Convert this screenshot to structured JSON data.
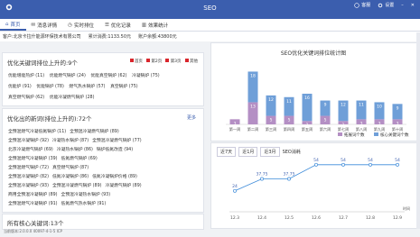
{
  "window": {
    "title": "SEO",
    "kefu": "客服",
    "settings": "设置"
  },
  "tabs": [
    {
      "label": "首页"
    },
    {
      "label": "消息详情"
    },
    {
      "label": "实时排位"
    },
    {
      "label": "优化记录"
    },
    {
      "label": "效果统计"
    }
  ],
  "info": {
    "customer": "客户:北京卡拉什能源环保技术有限公司",
    "spent": "累计消费:1133.50元",
    "balance": "账户余额:43800元"
  },
  "stats": {
    "title": "优化关键词排位上升的:9个",
    "legend": [
      "首页",
      "第2页",
      "第3页",
      "其他"
    ],
    "rows": [
      [
        "优能增能热炉 (11)",
        "优能燃气锅炉 (24)",
        "优能真空锅炉 (62)",
        "冷凝锅炉 (75)"
      ],
      [
        "优能炉 (91)",
        "优能锅炉 (78)",
        "燃气热水锅炉 (57)",
        "真空锅炉 (75)"
      ],
      [
        "真空燃气锅炉 (62)",
        "优能冷凝燃气锅炉 (28)"
      ]
    ]
  },
  "opt": {
    "title": "优化出的新词(排位上升的):72个",
    "more": "更多",
    "rows": [
      [
        "全预混燃气冷凝低氮锅炉 (11)",
        "全预混冷凝燃气锅炉 (89)"
      ],
      [
        "全预混冷凝锅炉 (92)",
        "冷凝热水锅炉 (87)",
        "全预混冷凝燃气锅炉 (77)"
      ],
      [
        "北京冷凝燃气锅炉 (69)",
        "冷凝热水锅炉 (86)",
        "锅炉低氮改造 (94)"
      ],
      [
        "全预混燃气冷凝锅炉 (39)",
        "低氮燃气锅炉 (69)"
      ],
      [
        "全预混燃气锅炉 (72)",
        "真空燃气锅炉 (87)"
      ],
      [
        "全预混冷凝锅炉 (82)",
        "低氮冷凝锅炉 (86)",
        "低氮冷凝锅炉价格 (89)"
      ],
      [
        "全预混冷凝锅炉 (93)",
        "全预混冷凝燃气锅炉 (89)",
        "冷凝燃气锅炉 (89)"
      ],
      [
        "商用全预混冷凝锅炉 (89)",
        "全预混冷凝热水锅炉 (93)"
      ],
      [
        "全预混燃气冷凝锅炉 (91)",
        "低氮燃气热水锅炉 (91)"
      ]
    ]
  },
  "total": {
    "label": "所有核心关键词:13个"
  },
  "chart_data": [
    {
      "type": "bar",
      "title": "SEO优化关键词排位统计图",
      "categories": [
        "第一周",
        "第二周",
        "第三周",
        "第四周",
        "第五周",
        "第六周",
        "第七周",
        "第八周",
        "第九周",
        "第十周"
      ],
      "series": [
        {
          "name": "拓展词个数",
          "values": [
            3,
            13,
            5,
            5,
            2,
            5,
            2,
            3,
            3,
            3
          ],
          "color": "#b48fc4"
        },
        {
          "name": "核心关键词个数",
          "values": [
            0,
            18,
            12,
            11,
            16,
            9,
            12,
            11,
            10,
            9
          ],
          "color": "#6f9fd8"
        }
      ],
      "ylim": [
        0,
        36
      ]
    },
    {
      "type": "line",
      "buttons": [
        "近7天",
        "近1月",
        "近3月"
      ],
      "title": "SEO消耗",
      "x": [
        "12.3",
        "12.4",
        "12.5",
        "12.6",
        "12.7",
        "12.8",
        "12.9"
      ],
      "values": [
        24,
        37.75,
        37.75,
        54,
        54,
        54,
        54
      ],
      "labels": [
        "24",
        "37.75",
        "37.75",
        "54",
        "54",
        "54",
        "54"
      ],
      "xlabel": "时间",
      "color": "#3b8ad9"
    }
  ],
  "footer": "当前版本:2.0.0.0 40097-4-1-5 ICP"
}
